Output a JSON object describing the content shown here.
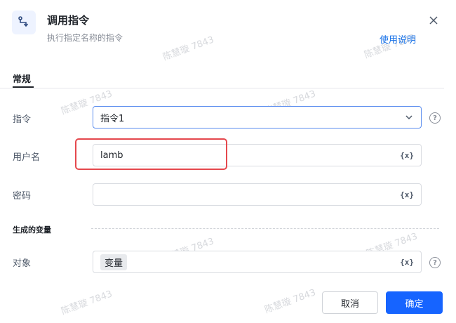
{
  "header": {
    "title": "调用指令",
    "subtitle": "执行指定名称的指令",
    "help_link": "使用说明"
  },
  "tabs": [
    {
      "label": "常规",
      "active": true
    }
  ],
  "form": {
    "command": {
      "label": "指令",
      "value": "指令1"
    },
    "username": {
      "label": "用户名",
      "value": "lamb"
    },
    "password": {
      "label": "密码",
      "value": ""
    },
    "object": {
      "label": "对象",
      "tag": "变量"
    }
  },
  "variable_glyph": "{x}",
  "help_glyph": "?",
  "section": {
    "generated_vars": "生成的变量"
  },
  "buttons": {
    "cancel": "取消",
    "ok": "确定"
  },
  "watermark": "陈慧璇 7843",
  "colors": {
    "primary": "#1664ff",
    "link": "#1a73e8",
    "highlight": "#e5484d"
  }
}
